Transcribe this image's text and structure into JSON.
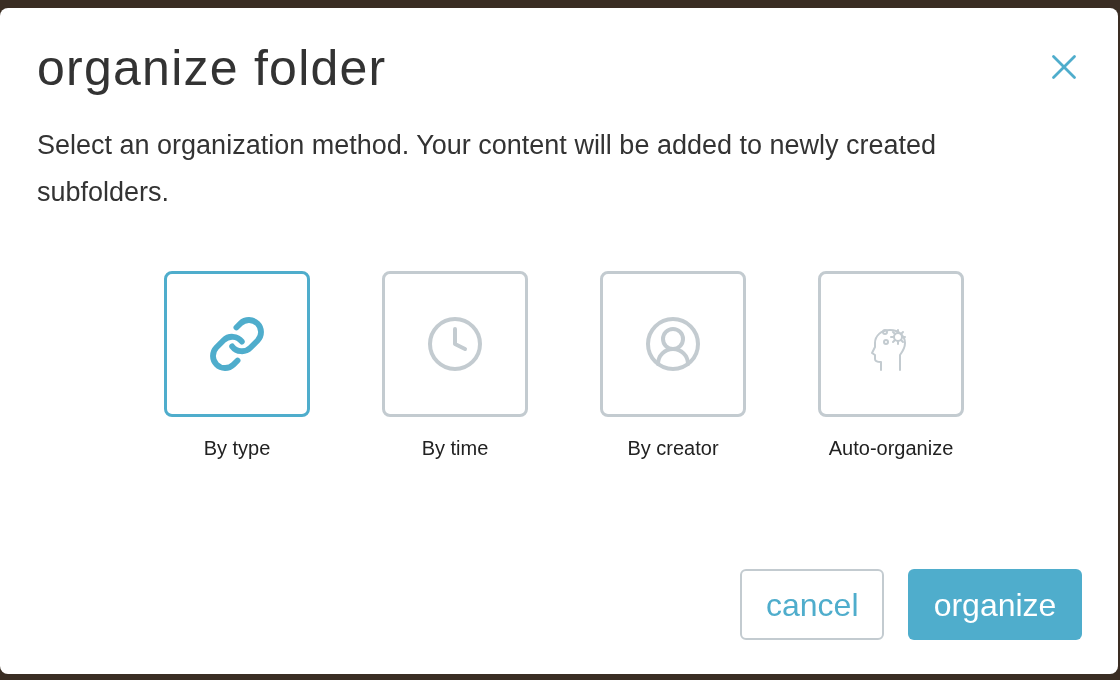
{
  "dialog": {
    "title": "organize folder",
    "description": "Select an organization method. Your content will be added to newly created subfolders."
  },
  "options": [
    {
      "kind": "type",
      "label": "By type",
      "selected": true
    },
    {
      "kind": "time",
      "label": "By time",
      "selected": false
    },
    {
      "kind": "creator",
      "label": "By creator",
      "selected": false
    },
    {
      "kind": "auto",
      "label": "Auto-organize",
      "selected": false
    }
  ],
  "buttons": [
    {
      "kind": "secondary",
      "label": "cancel"
    },
    {
      "kind": "primary",
      "label": "organize"
    }
  ]
}
